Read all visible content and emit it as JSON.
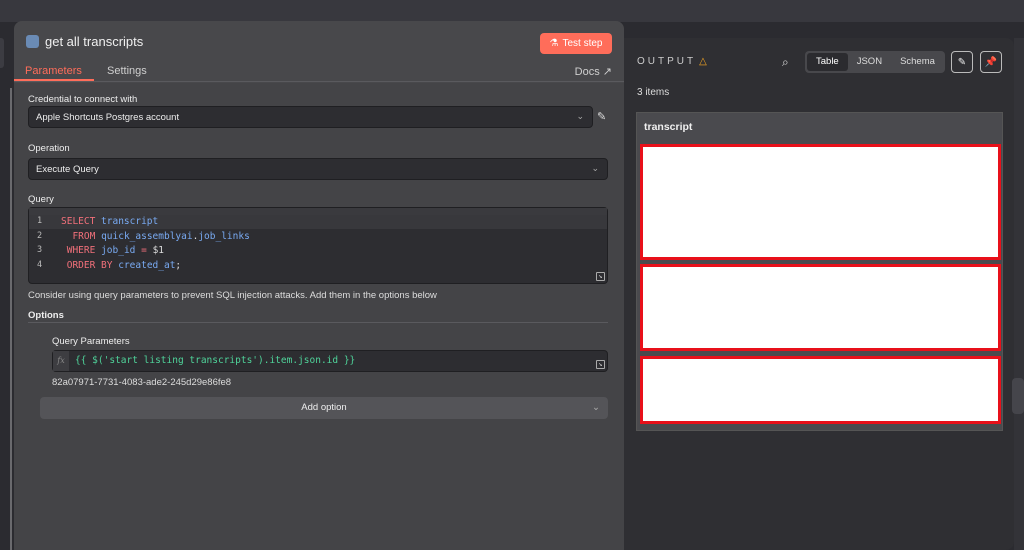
{
  "node": {
    "title": "get all transcripts",
    "test_label": "Test step"
  },
  "tabs": {
    "parameters": "Parameters",
    "settings": "Settings",
    "docs": "Docs"
  },
  "credential": {
    "label": "Credential to connect with",
    "value": "Apple Shortcuts Postgres account"
  },
  "operation": {
    "label": "Operation",
    "value": "Execute Query"
  },
  "query": {
    "label": "Query",
    "lines": [
      {
        "n": "1",
        "tokens": [
          [
            "kw",
            "SELECT "
          ],
          [
            "id",
            "transcript"
          ]
        ]
      },
      {
        "n": "2",
        "tokens": [
          [
            "pl",
            "  "
          ],
          [
            "kw",
            "FROM "
          ],
          [
            "id",
            "quick_assemblyai"
          ],
          [
            "pl",
            "."
          ],
          [
            "id",
            "job_links"
          ]
        ]
      },
      {
        "n": "3",
        "tokens": [
          [
            "pl",
            " "
          ],
          [
            "kw",
            "WHERE "
          ],
          [
            "id",
            "job_id "
          ],
          [
            "kw",
            "= "
          ],
          [
            "pl",
            "$1"
          ]
        ]
      },
      {
        "n": "4",
        "tokens": [
          [
            "pl",
            " "
          ],
          [
            "kw",
            "ORDER BY "
          ],
          [
            "id",
            "created_at"
          ],
          [
            "pl",
            ";"
          ]
        ]
      }
    ],
    "hint": "Consider using query parameters to prevent SQL injection attacks. Add them in the options below"
  },
  "options": {
    "label": "Options",
    "query_params_label": "Query Parameters",
    "fx": "fx",
    "expression": "{{ $('start listing transcripts').item.json.id }}",
    "resolved": "82a07971-7731-4083-ade2-245d29e86fe8",
    "add_option": "Add option"
  },
  "output": {
    "title": "OUTPUT",
    "warn": "△",
    "views": [
      "Table",
      "JSON",
      "Schema"
    ],
    "active_view": "Table",
    "count": "3 items",
    "column": "transcript",
    "rows": 3
  },
  "colors": {
    "accent": "#ff6d5a",
    "highlight": "#e8101a"
  }
}
